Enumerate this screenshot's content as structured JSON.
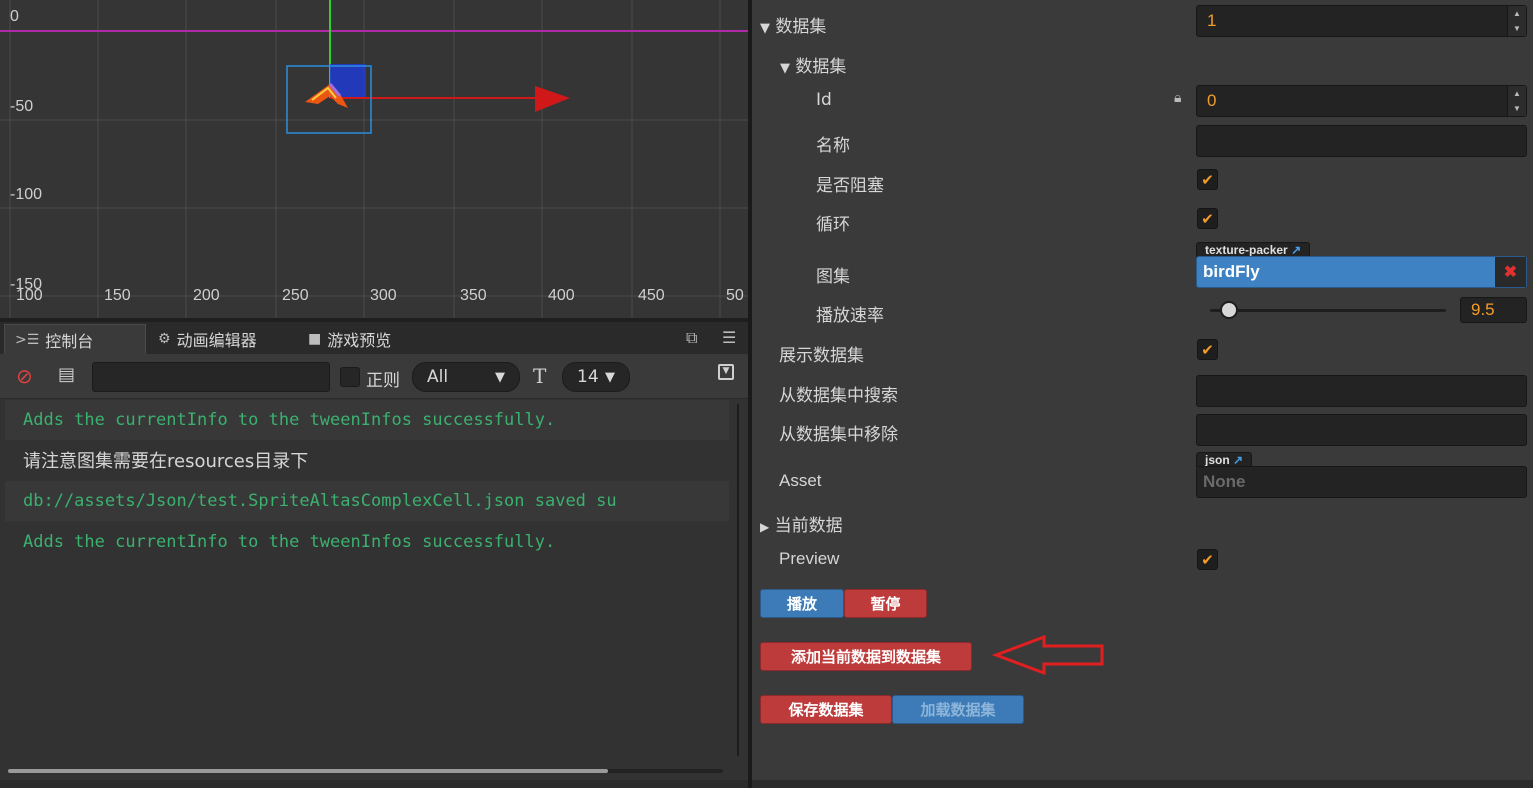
{
  "scene": {
    "x_ticks": [
      "100",
      "150",
      "200",
      "250",
      "300",
      "350",
      "400",
      "450",
      "50"
    ],
    "y_ticks": [
      "0",
      "-50",
      "-100",
      "-150"
    ]
  },
  "console": {
    "tabs": [
      {
        "label": "控制台",
        "icon": "console-icon"
      },
      {
        "label": "动画编辑器",
        "icon": "animation-icon"
      },
      {
        "label": "游戏预览",
        "icon": "camera-icon"
      }
    ],
    "toolbar": {
      "regex_label": "正则",
      "level_value": "All",
      "font_size_value": "14"
    },
    "logs": [
      {
        "text": "Adds the currentInfo to the tweenInfos successfully.",
        "style": "mono"
      },
      {
        "text": "请注意图集需要在resources目录下",
        "style": "plain"
      },
      {
        "text": "db://assets/Json/test.SpriteAltasComplexCell.json saved su",
        "style": "mono"
      },
      {
        "text": "Adds the currentInfo to the tweenInfos successfully.",
        "style": "mono"
      }
    ]
  },
  "inspector": {
    "dataset_label": "数据集",
    "dataset_value": "1",
    "sub_dataset_label": "数据集",
    "id_label": "Id",
    "id_value": "0",
    "name_label": "名称",
    "name_value": "",
    "block_label": "是否阻塞",
    "loop_label": "循环",
    "atlas_label": "图集",
    "atlas_type": "texture-packer",
    "atlas_value": "birdFly",
    "speed_label": "播放速率",
    "speed_value": "9.5",
    "speed_fraction": 0.08,
    "show_dataset_label": "展示数据集",
    "search_label": "从数据集中搜索",
    "remove_label": "从数据集中移除",
    "asset_label": "Asset",
    "asset_type": "json",
    "asset_value": "None",
    "current_data_label": "当前数据",
    "preview_label": "Preview",
    "play_button": "播放",
    "pause_button": "暂停",
    "add_button": "添加当前数据到数据集",
    "save_button": "保存数据集",
    "load_button": "加载数据集"
  },
  "colors": {
    "accent_orange": "#f39c2a",
    "button_blue": "#3c7bb7",
    "button_red": "#bd3b3b",
    "log_green": "#3bb16f",
    "arrow_red": "#e02020"
  }
}
